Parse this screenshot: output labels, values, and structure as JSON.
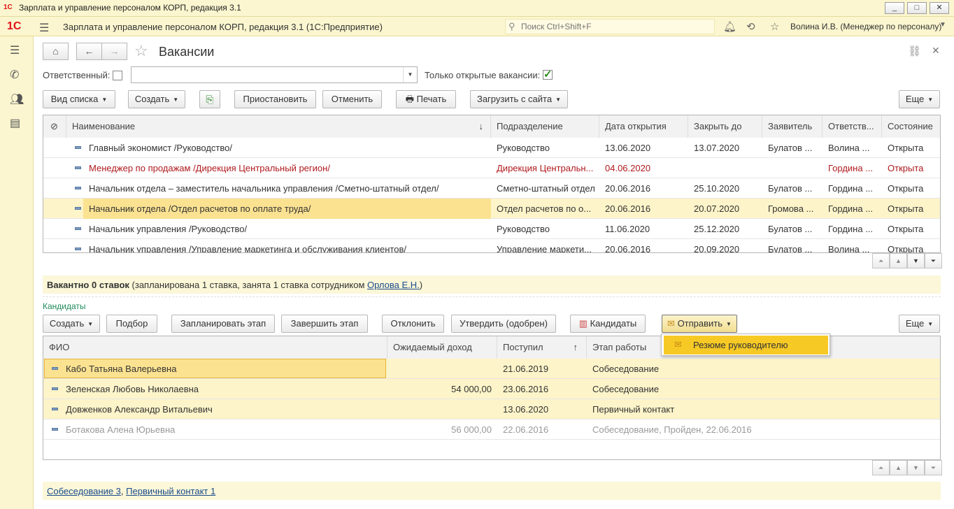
{
  "window": {
    "title": "Зарплата и управление персоналом КОРП, редакция 3.1",
    "minimize": "_",
    "maximize": "□",
    "close": "✕"
  },
  "appbar": {
    "logo": "1С",
    "app_title": "Зарплата и управление персоналом КОРП, редакция 3.1  (1С:Предприятие)",
    "search_placeholder": "Поиск Ctrl+Shift+F",
    "user": "Волина И.В. (Менеджер по персоналу)"
  },
  "form": {
    "title": "Вакансии",
    "responsible_label": "Ответственный:",
    "open_only_label": "Только открытые вакансии:",
    "open_only_checked": true
  },
  "toolbar": {
    "view_list": "Вид списка",
    "create": "Создать",
    "suspend": "Приостановить",
    "cancel": "Отменить",
    "print": "Печать",
    "load_from_site": "Загрузить с сайта",
    "more": "Еще"
  },
  "vacancies": {
    "columns": [
      "Наименование",
      "Подразделение",
      "Дата открытия",
      "Закрыть до",
      "Заявитель",
      "Ответств...",
      "Состояние"
    ],
    "rows": [
      {
        "name": "Главный экономист /Руководство/",
        "dept": "Руководство",
        "opened": "13.06.2020",
        "close_by": "13.07.2020",
        "applicant": "Булатов ...",
        "resp": "Волина ...",
        "status": "Открыта",
        "overdue": false,
        "selected": false
      },
      {
        "name": "Менеджер по продажам /Дирекция Центральный регион/",
        "dept": "Дирекция Центральн...",
        "opened": "04.06.2020",
        "close_by": "",
        "applicant": "",
        "resp": "Гордина ...",
        "status": "Открыта",
        "overdue": true,
        "selected": false
      },
      {
        "name": "Начальник отдела – заместитель начальника управления /Сметно-штатный отдел/",
        "dept": "Сметно-штатный отдел",
        "opened": "20.06.2016",
        "close_by": "25.10.2020",
        "applicant": "Булатов ...",
        "resp": "Гордина ...",
        "status": "Открыта",
        "overdue": false,
        "selected": false
      },
      {
        "name": "Начальник отдела /Отдел расчетов по оплате труда/",
        "dept": "Отдел расчетов по о...",
        "opened": "20.06.2016",
        "close_by": "20.07.2020",
        "applicant": "Громова ...",
        "resp": "Гордина ...",
        "status": "Открыта",
        "overdue": false,
        "selected": true
      },
      {
        "name": "Начальник управления /Руководство/",
        "dept": "Руководство",
        "opened": "11.06.2020",
        "close_by": "25.12.2020",
        "applicant": "Булатов ...",
        "resp": "Гордина ...",
        "status": "Открыта",
        "overdue": false,
        "selected": false
      },
      {
        "name": "Начальник управления /Управление маркетинга и обслуживания клиентов/",
        "dept": "Управление маркети...",
        "opened": "20.06.2016",
        "close_by": "20.09.2020",
        "applicant": "Булатов ...",
        "resp": "Волина ...",
        "status": "Открыта",
        "overdue": false,
        "selected": false
      }
    ]
  },
  "vacancy_info": {
    "bold": "Вакантно 0 ставок",
    "text": " (запланирована 1 ставка, занята 1 ставка сотрудником ",
    "link": "Орлова Е.Н.",
    "tail": ")"
  },
  "candidates": {
    "section_title": "Кандидаты",
    "toolbar": {
      "create": "Создать",
      "pick": "Подбор",
      "plan_stage": "Запланировать этап",
      "finish_stage": "Завершить этап",
      "reject": "Отклонить",
      "approve": "Утвердить (одобрен)",
      "candidates": "Кандидаты",
      "send": "Отправить",
      "more": "Еще"
    },
    "send_menu": [
      "Резюме руководителю"
    ],
    "columns": [
      "ФИО",
      "Ожидаемый доход",
      "Поступил",
      "Этап работы"
    ],
    "rows": [
      {
        "fio": "Кабо Татьяна Валерьевна",
        "income": "",
        "received": "21.06.2019",
        "stage": "Собеседование",
        "dimmed": false
      },
      {
        "fio": "Зеленская Любовь Николаевна",
        "income": "54 000,00",
        "received": "23.06.2016",
        "stage": "Собеседование",
        "dimmed": false
      },
      {
        "fio": "Довженков Александр Витальевич",
        "income": "",
        "received": "13.06.2020",
        "stage": "Первичный контакт",
        "dimmed": false
      },
      {
        "fio": "Ботакова Алена Юрьевна",
        "income": "56 000,00",
        "received": "22.06.2016",
        "stage": "Собеседование, Пройден, 22.06.2016",
        "dimmed": true
      }
    ],
    "footer_links": [
      "Собеседование 3",
      "Первичный контакт 1"
    ],
    "footer_sep": ", "
  },
  "colors": {
    "accent_yellow": "#f7c925",
    "selected_row": "#fbe291",
    "overdue_red": "#b0191e",
    "panel_bg": "#fbf6cf"
  }
}
